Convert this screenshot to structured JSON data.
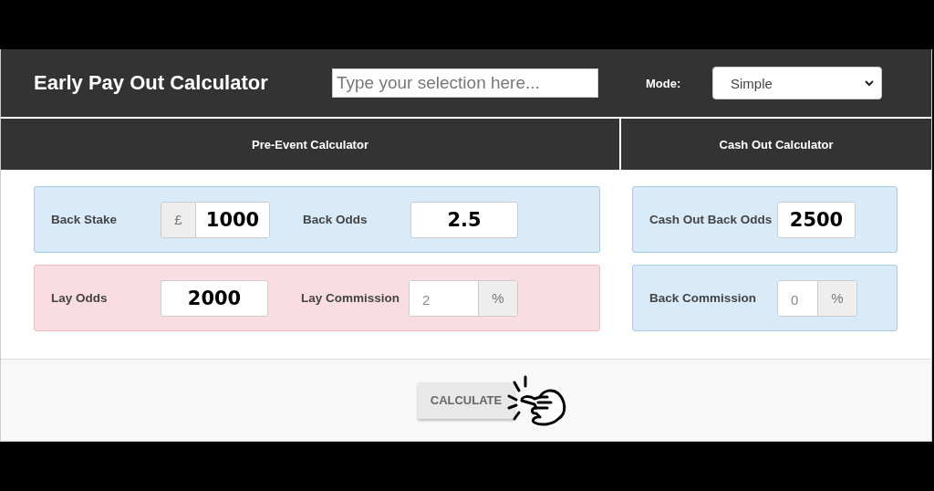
{
  "header": {
    "title": "Early Pay Out Calculator",
    "search": {
      "placeholder": "Type your selection here..."
    },
    "mode": {
      "label": "Mode:",
      "value": "Simple"
    }
  },
  "sections": [
    {
      "heading": "Pre-Event Calculator",
      "rows": [
        {
          "color": "#d9eaf8",
          "fields": [
            {
              "label": "Back Stake",
              "kind": "prefix",
              "addon": "£",
              "value": "1000"
            },
            {
              "label": "Back Odds",
              "kind": "plain",
              "value": "2.5"
            }
          ]
        },
        {
          "color": "#fadde3",
          "fields": [
            {
              "label": "Lay Odds",
              "kind": "plain",
              "value": "2000"
            },
            {
              "label": "Lay Commission",
              "kind": "suffix",
              "addon": "%",
              "placeholder": "2"
            }
          ]
        }
      ]
    },
    {
      "heading": "Cash Out Calculator",
      "rows": [
        {
          "color": "#d9eaf8",
          "fields": [
            {
              "label": "Cash Out Back Odds",
              "kind": "plain",
              "value": "2500"
            }
          ]
        },
        {
          "color": "#d9eaf8",
          "fields": [
            {
              "label": "Back Commission",
              "kind": "suffix",
              "addon": "%",
              "placeholder": "0"
            }
          ]
        }
      ]
    }
  ],
  "button": {
    "label": "CALCULATE"
  }
}
